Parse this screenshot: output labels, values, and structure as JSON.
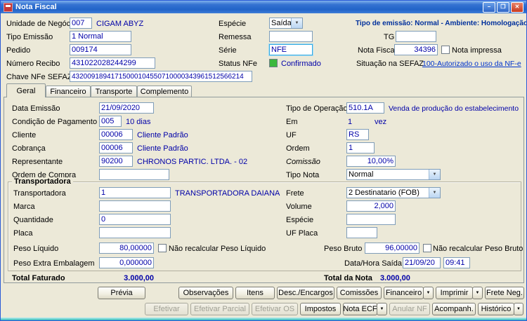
{
  "window": {
    "title": "Nota Fiscal"
  },
  "icons": {
    "dropdown": "▼",
    "minimize": "–",
    "maximize": "❐",
    "close": "✕"
  },
  "colors": {
    "value_blue": "#0000A8",
    "link_blue": "#0033CC",
    "status_green": "#3CB83C",
    "info_navy": "#00309C"
  },
  "header": {
    "unidade_negocio_label": "Unidade de Negócio",
    "unidade_negocio_code": "007",
    "unidade_negocio_name": "CIGAM ABYZ",
    "especie_label": "Espécie",
    "especie_value": "Saída",
    "emissao_info": "Tipo de emissão: Normal - Ambiente: Homologação",
    "tipo_emissao_label": "Tipo Emissão",
    "tipo_emissao_value": "1 Normal",
    "remessa_label": "Remessa",
    "remessa_value": "",
    "tg_label": "TG",
    "tg_value": "",
    "pedido_label": "Pedido",
    "pedido_value": "009174",
    "serie_label": "Série",
    "serie_value": "NFE",
    "nota_fiscal_label": "Nota Fiscal",
    "nota_fiscal_value": "34396",
    "nota_impressa_label": "Nota impressa",
    "numero_recibo_label": "Número Recibo",
    "numero_recibo_value": "431022028244299",
    "status_nfe_label": "Status NFe",
    "status_nfe_value": "Confirmado",
    "situacao_sefaz_label": "Situação na SEFAZ",
    "situacao_sefaz_value": "100-Autorizado o uso da NF-e",
    "chave_label": "Chave NFe SEFAZ",
    "chave_value": "43200918941715000104550710000343961512566214"
  },
  "tabs": {
    "geral": "Geral",
    "financeiro": "Financeiro",
    "transporte": "Transporte",
    "complemento": "Complemento"
  },
  "geral": {
    "data_emissao_label": "Data Emissão",
    "data_emissao_value": "21/09/2020",
    "cond_pag_label": "Condição de Pagamento",
    "cond_pag_code": "005",
    "cond_pag_desc": "10 dias",
    "cliente_label": "Cliente",
    "cliente_code": "00006",
    "cliente_name": "Cliente Padrão",
    "cobranca_label": "Cobrança",
    "cobranca_code": "00006",
    "cobranca_name": "Cliente Padrão",
    "representante_label": "Representante",
    "representante_code": "90200",
    "representante_name": "CHRONOS PARTIC. LTDA. - 02",
    "ordem_compra_label": "Ordem de Compra",
    "ordem_compra_value": "",
    "tipo_operacao_label": "Tipo de Operação",
    "tipo_operacao_code": "510.1A",
    "tipo_operacao_desc": "Venda de produção do estabelecimento",
    "em_label": "Em",
    "em_value": "1",
    "em_suffix": "vez",
    "uf_label": "UF",
    "uf_value": "RS",
    "ordem_label": "Ordem",
    "ordem_value": "1",
    "comissao_label": "Comissão",
    "comissao_value": "10,00%",
    "tipo_nota_label": "Tipo Nota",
    "tipo_nota_value": "Normal"
  },
  "transportadora": {
    "group_title": "Transportadora",
    "transportadora_label": "Transportadora",
    "transportadora_code": "1",
    "transportadora_name": "TRANSPORTADORA DAIANA",
    "frete_label": "Frete",
    "frete_value": "2 Destinatario (FOB)",
    "marca_label": "Marca",
    "marca_value": "",
    "volume_label": "Volume",
    "volume_value": "2,000",
    "quantidade_label": "Quantidade",
    "quantidade_value": "0",
    "especie_label": "Espécie",
    "especie_value": "",
    "placa_label": "Placa",
    "placa_value": "",
    "uf_placa_label": "UF Placa",
    "uf_placa_value": "",
    "peso_liquido_label": "Peso Líquido",
    "peso_liquido_value": "80,00000",
    "peso_liquido_check": "Não recalcular Peso Líquido",
    "peso_bruto_label": "Peso Bruto",
    "peso_bruto_value": "96,00000",
    "peso_bruto_check": "Não recalcular Peso Bruto",
    "peso_extra_label": "Peso Extra Embalagem",
    "peso_extra_value": "0,000000",
    "data_hora_label": "Data/Hora Saída",
    "data_saida_value": "21/09/20",
    "hora_saida_value": "09:41"
  },
  "totals": {
    "faturado_label": "Total Faturado",
    "faturado_value": "3.000,00",
    "nota_label": "Total da Nota",
    "nota_value": "3.000,00"
  },
  "buttons": {
    "previa": "Prévia",
    "observacoes": "Observações",
    "itens": "Itens",
    "desc_encargos": "Desc./Encargos",
    "comissoes": "Comissões",
    "financeiro": "Financeiro",
    "imprimir": "Imprimir",
    "frete_neg": "Frete Neg.",
    "efetivar": "Efetivar",
    "efetivar_parcial": "Efetivar Parcial",
    "efetivar_os": "Efetivar OS",
    "impostos": "Impostos",
    "nota_ecf": "Nota ECF",
    "anular_nf": "Anular NF",
    "acompanh": "Acompanh.",
    "historico": "Histórico"
  }
}
